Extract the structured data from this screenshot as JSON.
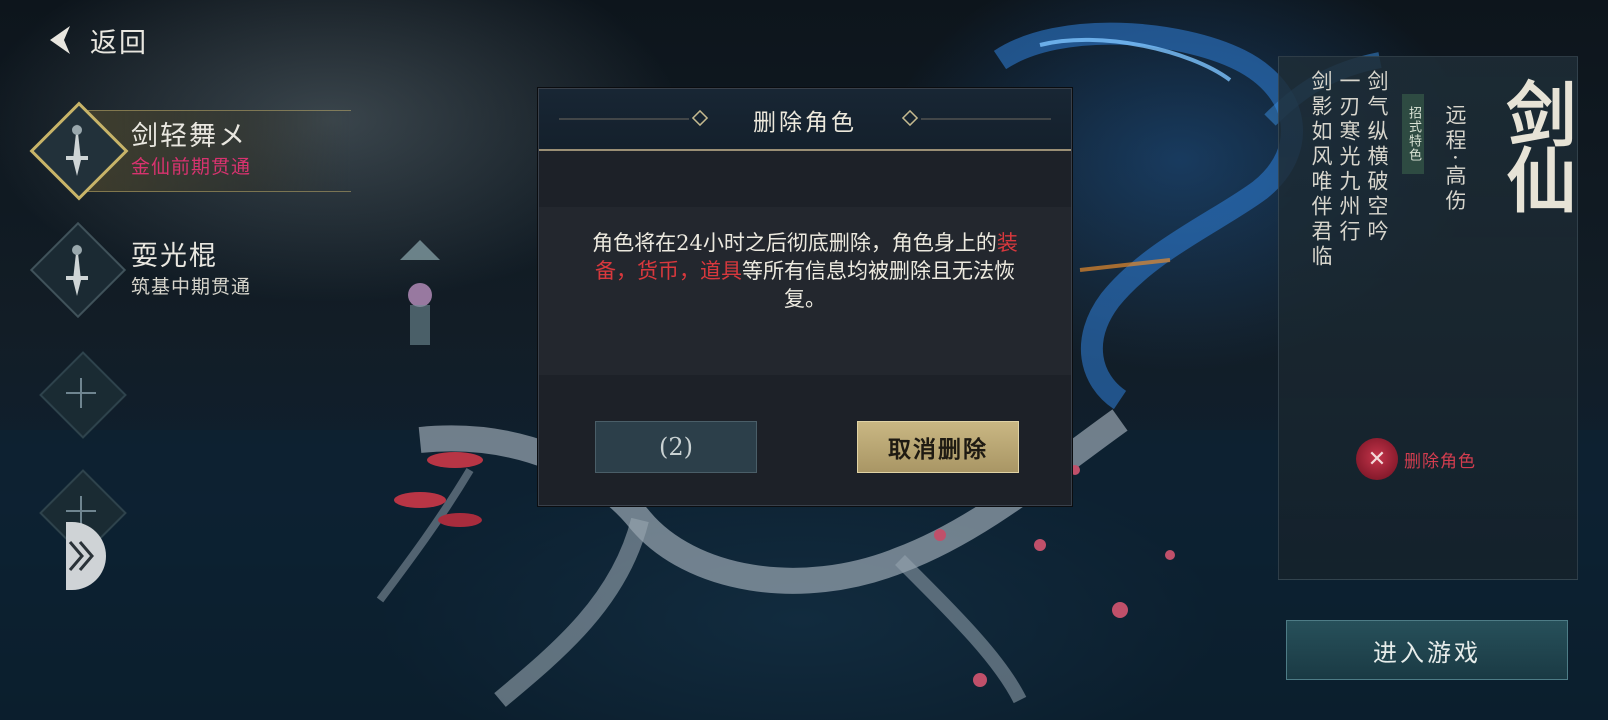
{
  "colors": {
    "accent_gold": "#c8b468",
    "highlight_red": "#d8383d",
    "realm_pink": "#d8336f",
    "enter_button": "#1f4650"
  },
  "topbar": {
    "back_label": "返回",
    "back_icon": "chevron-left-icon"
  },
  "character_slots": [
    {
      "name": "剑轻舞メ",
      "realm": "金仙前期贯通",
      "realm_color": "#d8336f",
      "selected": true,
      "icon": "sword-emblem-icon"
    },
    {
      "name": "耍光棍",
      "realm": "筑基中期贯通",
      "realm_color": "#d7d5cc",
      "selected": false,
      "icon": "sword-emblem-icon"
    }
  ],
  "empty_slots": [
    {
      "icon": "plus-icon"
    },
    {
      "icon": "plus-icon"
    }
  ],
  "class_info": {
    "class_name": "剑仙",
    "attack_type": "远程·高伤",
    "feature_tag": "招式特色",
    "poem_lines": [
      "剑气纵横破空吟",
      "一刃寒光九州行",
      "剑影如风唯伴君临"
    ],
    "delete_role_label": "删除角色",
    "delete_role_icon": "delete-role-icon",
    "enter_game_label": "进入游戏"
  },
  "dialog": {
    "title": "删除角色",
    "message_part1": "角色将在24小时之后彻底删除，角色身上的",
    "message_highlight": "装备，货币，道具",
    "message_part2": "等所有信息均被删除且无法恢复。",
    "countdown_label": "(2)",
    "cancel_delete_label": "取消删除"
  }
}
